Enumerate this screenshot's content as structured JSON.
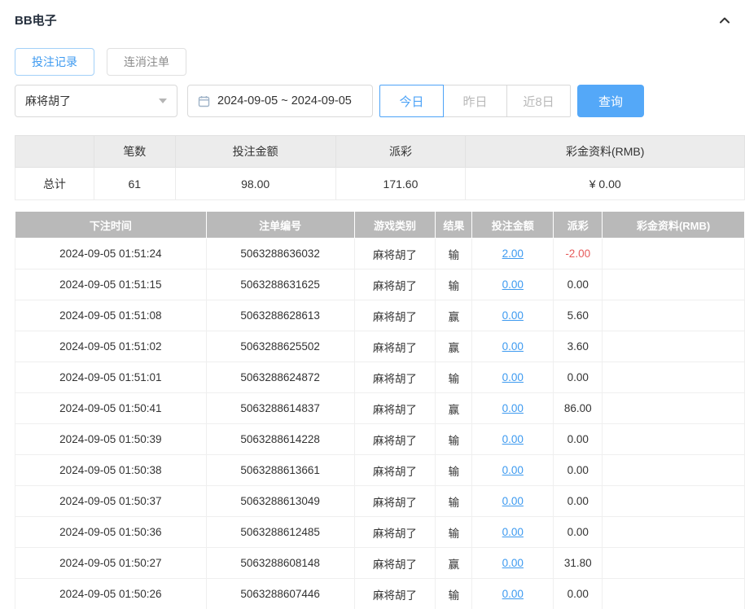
{
  "header": {
    "title": "BB电子"
  },
  "tabs": [
    {
      "label": "投注记录"
    },
    {
      "label": "连消注单"
    }
  ],
  "filters": {
    "game_select": "麻将胡了",
    "date_range": "2024-09-05 ~ 2024-09-05",
    "quick_buttons": [
      {
        "label": "今日"
      },
      {
        "label": "昨日"
      },
      {
        "label": "近8日"
      }
    ],
    "search_label": "查询"
  },
  "summary": {
    "headers": [
      "",
      "笔数",
      "投注金额",
      "派彩",
      "彩金资料(RMB)"
    ],
    "row_label": "总计",
    "count": "61",
    "bet_amount": "98.00",
    "payout": "171.60",
    "jackpot": "¥ 0.00"
  },
  "table": {
    "headers": [
      "下注时间",
      "注单编号",
      "游戏类别",
      "结果",
      "投注金额",
      "派彩",
      "彩金资料(RMB)"
    ],
    "rows": [
      {
        "time": "2024-09-05 01:51:24",
        "order": "5063288636032",
        "game": "麻将胡了",
        "result": "输",
        "bet": "2.00",
        "payout": "-2.00",
        "jackpot": ""
      },
      {
        "time": "2024-09-05 01:51:15",
        "order": "5063288631625",
        "game": "麻将胡了",
        "result": "输",
        "bet": "0.00",
        "payout": "0.00",
        "jackpot": ""
      },
      {
        "time": "2024-09-05 01:51:08",
        "order": "5063288628613",
        "game": "麻将胡了",
        "result": "赢",
        "bet": "0.00",
        "payout": "5.60",
        "jackpot": ""
      },
      {
        "time": "2024-09-05 01:51:02",
        "order": "5063288625502",
        "game": "麻将胡了",
        "result": "赢",
        "bet": "0.00",
        "payout": "3.60",
        "jackpot": ""
      },
      {
        "time": "2024-09-05 01:51:01",
        "order": "5063288624872",
        "game": "麻将胡了",
        "result": "输",
        "bet": "0.00",
        "payout": "0.00",
        "jackpot": ""
      },
      {
        "time": "2024-09-05 01:50:41",
        "order": "5063288614837",
        "game": "麻将胡了",
        "result": "赢",
        "bet": "0.00",
        "payout": "86.00",
        "jackpot": ""
      },
      {
        "time": "2024-09-05 01:50:39",
        "order": "5063288614228",
        "game": "麻将胡了",
        "result": "输",
        "bet": "0.00",
        "payout": "0.00",
        "jackpot": ""
      },
      {
        "time": "2024-09-05 01:50:38",
        "order": "5063288613661",
        "game": "麻将胡了",
        "result": "输",
        "bet": "0.00",
        "payout": "0.00",
        "jackpot": ""
      },
      {
        "time": "2024-09-05 01:50:37",
        "order": "5063288613049",
        "game": "麻将胡了",
        "result": "输",
        "bet": "0.00",
        "payout": "0.00",
        "jackpot": ""
      },
      {
        "time": "2024-09-05 01:50:36",
        "order": "5063288612485",
        "game": "麻将胡了",
        "result": "输",
        "bet": "0.00",
        "payout": "0.00",
        "jackpot": ""
      },
      {
        "time": "2024-09-05 01:50:27",
        "order": "5063288608148",
        "game": "麻将胡了",
        "result": "赢",
        "bet": "0.00",
        "payout": "31.80",
        "jackpot": ""
      },
      {
        "time": "2024-09-05 01:50:26",
        "order": "5063288607446",
        "game": "麻将胡了",
        "result": "输",
        "bet": "0.00",
        "payout": "0.00",
        "jackpot": ""
      }
    ]
  }
}
